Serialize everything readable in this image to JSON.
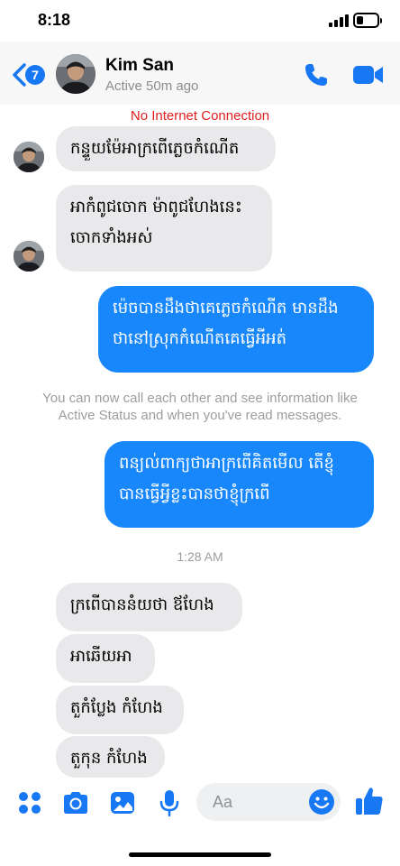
{
  "status_bar": {
    "time": "8:18",
    "battery_level": 0.35
  },
  "header": {
    "back_badge": "7",
    "contact_name": "Kim San",
    "contact_status": "Active 50m ago",
    "accent_color": "#1877f2"
  },
  "banner": {
    "no_internet": "No Internet Connection",
    "color": "#e02020"
  },
  "messages": [
    {
      "side": "in",
      "lines": [
        "កន្ទួយម៉ែអាក្រពើភ្លេចកំណើត"
      ]
    },
    {
      "side": "in",
      "lines": [
        "អាកំពូជចោក ម៉ាពូជហែងនេះ",
        "ចោកទាំងអស់"
      ]
    },
    {
      "side": "out",
      "lines": [
        "ម៉េចបានដឹងថាគេភ្លេចកំណើត មានដឹង",
        "ថានៅស្រុកកំណើតគេធ្វើអីអត់"
      ]
    },
    {
      "side": "out",
      "lines": [
        "ពន្យល់ពាក្យថាអាក្រពើគិតមើល តើខ្ញុំ",
        "បានធ្វើអ្វីខ្លះបានថាខ្ញុំក្រពើ"
      ]
    },
    {
      "side": "in",
      "lines": [
        "ក្រពើបាននំយថា ឪហែង"
      ]
    },
    {
      "side": "in",
      "lines": [
        "អាឆើយអា"
      ]
    },
    {
      "side": "in",
      "lines": [
        "តួកំប្លែង កំហែង"
      ]
    },
    {
      "side": "in",
      "lines": [
        "តួកុន កំហែង"
      ]
    }
  ],
  "system_note": {
    "line1": "You can now call each other and see information like",
    "line2": "Active Status and when you've read messages."
  },
  "timestamp": "1:28 AM",
  "composer": {
    "placeholder": "Aa",
    "icons": [
      "apps-icon",
      "camera-icon",
      "photo-icon",
      "microphone-icon",
      "emoji-icon",
      "like-icon"
    ]
  },
  "colors": {
    "outgoing_bubble": "#1787fb",
    "incoming_bubble": "#e9e9eb"
  }
}
